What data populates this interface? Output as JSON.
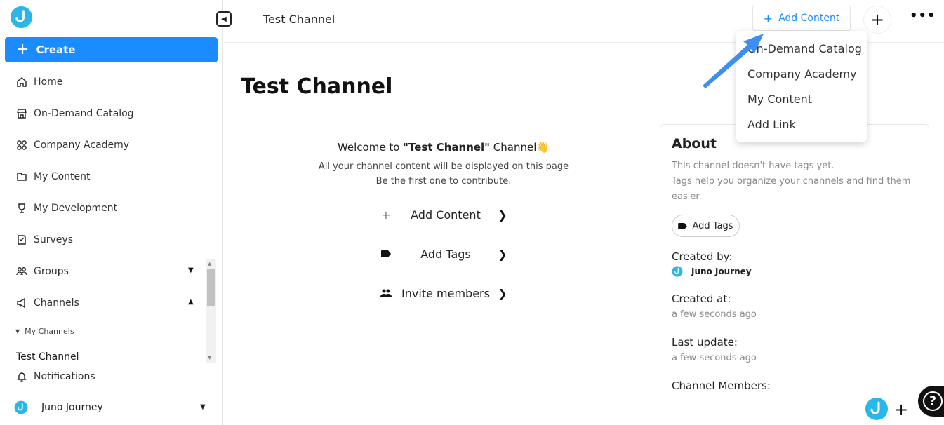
{
  "colors": {
    "accent": "#1a8cff",
    "brand_cyan": "#29b6e8",
    "help_bg": "#111111"
  },
  "sidebar": {
    "create_label": "Create",
    "items": [
      {
        "label": "Home",
        "icon": "home-icon"
      },
      {
        "label": "On-Demand Catalog",
        "icon": "store-icon"
      },
      {
        "label": "Company Academy",
        "icon": "grid-icon"
      },
      {
        "label": "My Content",
        "icon": "folder-icon"
      },
      {
        "label": "My Development",
        "icon": "trophy-icon"
      },
      {
        "label": "Surveys",
        "icon": "survey-icon"
      },
      {
        "label": "Groups",
        "icon": "groups-icon"
      },
      {
        "label": "Channels",
        "icon": "megaphone-icon"
      }
    ],
    "my_channels_label": "My Channels",
    "channel_item": "Test Channel",
    "notifications_label": "Notifications",
    "user_name": "Juno Journey"
  },
  "header": {
    "title": "Test Channel",
    "add_content_label": "Add Content"
  },
  "dropdown": {
    "items": [
      "On-Demand Catalog",
      "Company Academy",
      "My Content",
      "Add Link"
    ]
  },
  "main": {
    "page_title": "Test Channel",
    "welcome_prefix": "Welcome to ",
    "welcome_channel": "\"Test Channel\"",
    "welcome_suffix": " Channel",
    "welcome_emoji": "👋",
    "line1": "All your channel content will be displayed on this page",
    "line2": "Be the first one to contribute.",
    "actions": [
      {
        "label": "Add Content",
        "icon": "plus-icon"
      },
      {
        "label": "Add Tags",
        "icon": "tag-icon"
      },
      {
        "label": "Invite members",
        "icon": "people-icon"
      }
    ]
  },
  "about": {
    "title": "About",
    "desc_line1": "This channel doesn't have tags yet.",
    "desc_line2": "Tags help you organize your channels and find them easier.",
    "add_tags_label": "Add Tags",
    "created_by_label": "Created by:",
    "created_by_value": "Juno Journey",
    "created_at_label": "Created at:",
    "created_at_value": "a few seconds ago",
    "last_update_label": "Last update:",
    "last_update_value": "a few seconds ago",
    "members_label": "Channel Members:"
  }
}
